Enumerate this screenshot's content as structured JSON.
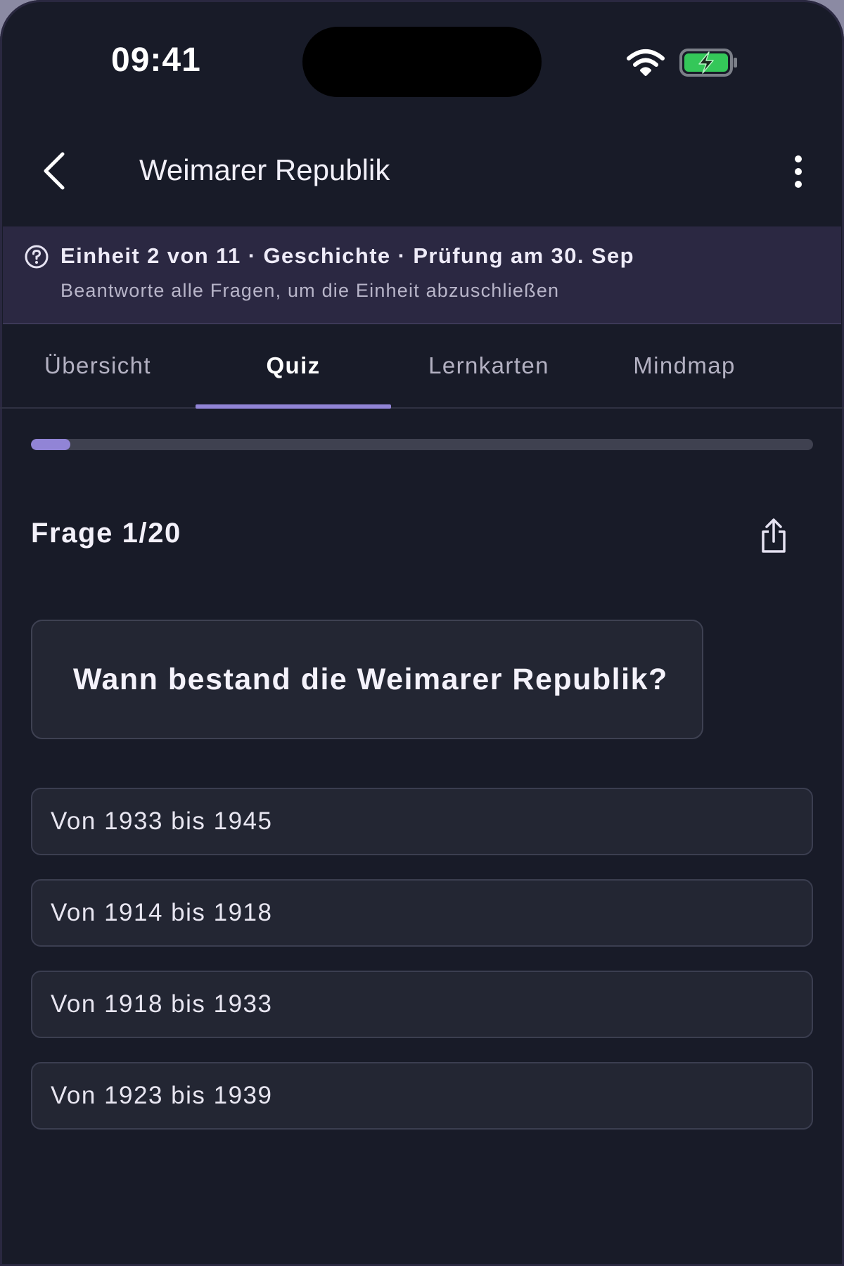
{
  "status_bar": {
    "time": "09:41",
    "battery_color": "#34c759"
  },
  "nav": {
    "title": "Weimarer Republik"
  },
  "banner": {
    "headline": "Einheit 2 von 11 · Geschichte · Prüfung am 30. Sep",
    "subtitle": "Beantworte alle Fragen, um die Einheit abzuschließen"
  },
  "tabs": [
    {
      "label": "Übersicht",
      "active": false
    },
    {
      "label": "Quiz",
      "active": true
    },
    {
      "label": "Lernkarten",
      "active": false
    },
    {
      "label": "Mindmap",
      "active": false
    }
  ],
  "quiz": {
    "progress_fraction": 0.05,
    "counter": "Frage 1/20",
    "question": "Wann bestand die Weimarer Republik?",
    "answers": [
      "Von 1933 bis 1945",
      "Von 1914 bis 1918",
      "Von 1918 bis 1933",
      "Von 1923 bis 1939"
    ]
  },
  "colors": {
    "accent": "#9184d6",
    "background": "#181b28",
    "banner": "#2b2842"
  }
}
